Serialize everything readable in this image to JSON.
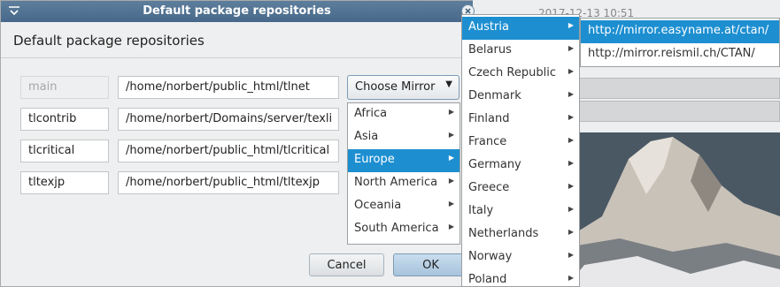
{
  "window": {
    "title": "Default package repositories",
    "heading": "Default package repositories"
  },
  "repos": [
    {
      "name": "main",
      "path": "/home/norbert/public_html/tlnet"
    },
    {
      "name": "tlcontrib",
      "path": "/home/norbert/Domains/server/texli"
    },
    {
      "name": "tlcritical",
      "path": "/home/norbert/public_html/tlcritical"
    },
    {
      "name": "tltexjp",
      "path": "/home/norbert/public_html/tltexjp"
    }
  ],
  "choose_mirror_label": "Choose Mirror",
  "buttons": {
    "cancel": "Cancel",
    "ok": "OK"
  },
  "regions": [
    "Africa",
    "Asia",
    "Europe",
    "North America",
    "Oceania",
    "South America"
  ],
  "countries": [
    "Austria",
    "Belarus",
    "Czech Republic",
    "Denmark",
    "Finland",
    "France",
    "Germany",
    "Greece",
    "Italy",
    "Netherlands",
    "Norway",
    "Poland"
  ],
  "mirrors": [
    "http://mirror.easyname.at/ctan/",
    "http://mirror.reismil.ch/CTAN/"
  ],
  "background": {
    "timestamp": "2017-12-13 10:51"
  },
  "colors": {
    "titlebar": "#4f7191",
    "selection": "#1d8fd1"
  }
}
